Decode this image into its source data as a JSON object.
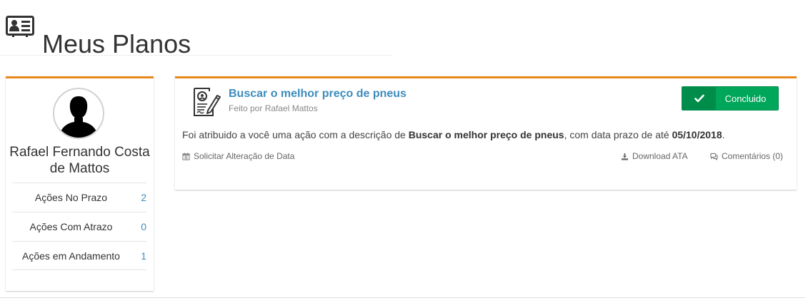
{
  "header": {
    "title": "Meus Planos",
    "icon": "id-card-icon"
  },
  "profile": {
    "name": "Rafael Fernando Costa de Mattos",
    "stats": [
      {
        "label": "Ações No Prazo",
        "value": "2"
      },
      {
        "label": "Ações Com Atrazo",
        "value": "0"
      },
      {
        "label": "Ações em Andamento",
        "value": "1"
      }
    ]
  },
  "task": {
    "icon": "contract-signature-icon",
    "title": "Buscar o melhor preço de pneus",
    "author": "Feito por Rafael Mattos",
    "status_label": "Concluido",
    "description_prefix": "Foi atribuido a você uma ação com a descrição de ",
    "description_name": "Buscar o melhor preço de pneus",
    "description_middle": ", com data prazo de até ",
    "description_date": "05/10/2018",
    "description_suffix": ".",
    "actions": {
      "request_change": "Solicitar Alteração de Data",
      "download": "Download ATA",
      "comments": "Comentários (0)"
    }
  },
  "colors": {
    "accent": "#e8891c",
    "link": "#3c8dbc",
    "success": "#00a65a"
  }
}
